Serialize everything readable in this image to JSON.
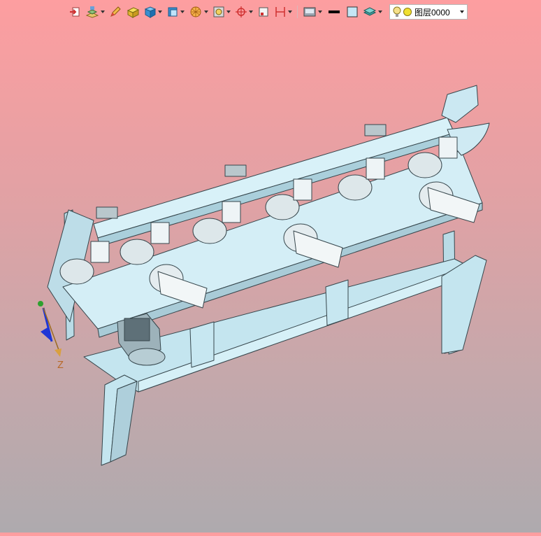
{
  "toolbar": {
    "tools": [
      {
        "id": "insert-icon",
        "kind": "red"
      },
      {
        "id": "layer-manager-icon",
        "kind": "orange"
      },
      {
        "id": "pencil-icon",
        "kind": "orange"
      },
      {
        "id": "eraser-box-icon",
        "kind": "yellow"
      },
      {
        "id": "solid-cube-icon",
        "kind": "blue"
      },
      {
        "id": "view-cube-icon",
        "kind": "blue"
      },
      {
        "id": "render-sphere-icon",
        "kind": "orange"
      },
      {
        "id": "zoom-fit-icon",
        "kind": "gray"
      },
      {
        "id": "snap-target-icon",
        "kind": "red"
      },
      {
        "id": "frame-icon",
        "kind": "gray"
      },
      {
        "id": "dimension-icon",
        "kind": "red"
      },
      {
        "id": "display-mode-icon",
        "kind": "gray"
      },
      {
        "id": "line-color-icon",
        "kind": "black"
      },
      {
        "id": "fill-color-icon",
        "kind": "lightblue"
      },
      {
        "id": "layers-stack-icon",
        "kind": "teal"
      }
    ],
    "layer": {
      "value": "图层0000",
      "bulb_color": "#f5e08a",
      "dot_color": "#f0e030"
    }
  },
  "viewport": {
    "axis_z_label": "Z",
    "model_color": "#c9e9f2",
    "edge_color": "#36464c"
  }
}
